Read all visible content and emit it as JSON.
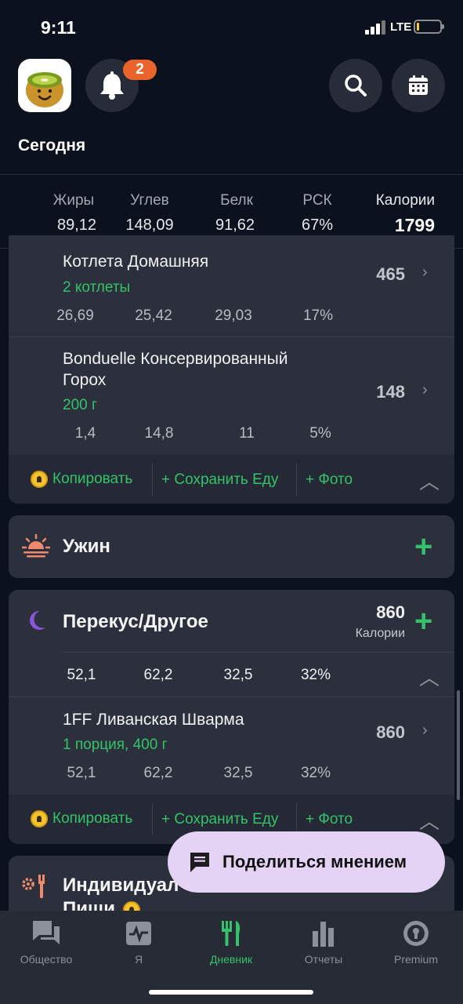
{
  "status": {
    "time": "9:11",
    "network": "LTE"
  },
  "header": {
    "notif_count": "2",
    "title": "Сегодня"
  },
  "summary": {
    "labels": [
      "Жиры",
      "Углев",
      "Белк",
      "РСК"
    ],
    "values": [
      "89,12",
      "148,09",
      "91,62",
      "67%"
    ],
    "calories_label": "Калории",
    "calories_value": "1799"
  },
  "lunch": {
    "items": [
      {
        "name": "Котлета Домашняя",
        "portion": "2 котлеты",
        "calories": "465",
        "nums": [
          "26,69",
          "25,42",
          "29,03",
          "17%"
        ]
      },
      {
        "name_line1": "Bonduelle Консервированный",
        "name_line2": "Горох",
        "portion": "200 г",
        "calories": "148",
        "nums": [
          "1,4",
          "14,8",
          "11",
          "5%"
        ]
      }
    ],
    "actions": {
      "copy": "Копировать",
      "save": "+ Сохранить Еду",
      "photo": "+ Фото"
    }
  },
  "dinner": {
    "title": "Ужин"
  },
  "snack": {
    "title": "Перекус/Другое",
    "calories": "860",
    "calories_label": "Калории",
    "totals": [
      "52,1",
      "62,2",
      "32,5",
      "32%"
    ],
    "items": [
      {
        "name": "1FF Ливанская Шварма",
        "portion": "1 порция, 400 г",
        "calories": "860",
        "nums": [
          "52,1",
          "62,2",
          "32,5",
          "32%"
        ]
      }
    ],
    "actions": {
      "copy": "Копировать",
      "save": "+ Сохранить Еду",
      "photo": "+ Фото"
    }
  },
  "custom": {
    "title_line1": "Индивидуал",
    "title_line2": "Пищи"
  },
  "feedback": {
    "label": "Поделиться мнением"
  },
  "tabs": [
    {
      "label": "Общество",
      "icon": "chat-icon"
    },
    {
      "label": "Я",
      "icon": "heart-pulse-icon"
    },
    {
      "label": "Дневник",
      "icon": "fork-knife-icon",
      "active": true
    },
    {
      "label": "Отчеты",
      "icon": "bar-chart-icon"
    },
    {
      "label": "Premium",
      "icon": "premium-icon"
    }
  ],
  "colors": {
    "accent": "#34c369",
    "badge": "#e8642a",
    "background": "#0c111e",
    "card": "#2b303c",
    "feedback_bg": "#e5d3f6"
  }
}
